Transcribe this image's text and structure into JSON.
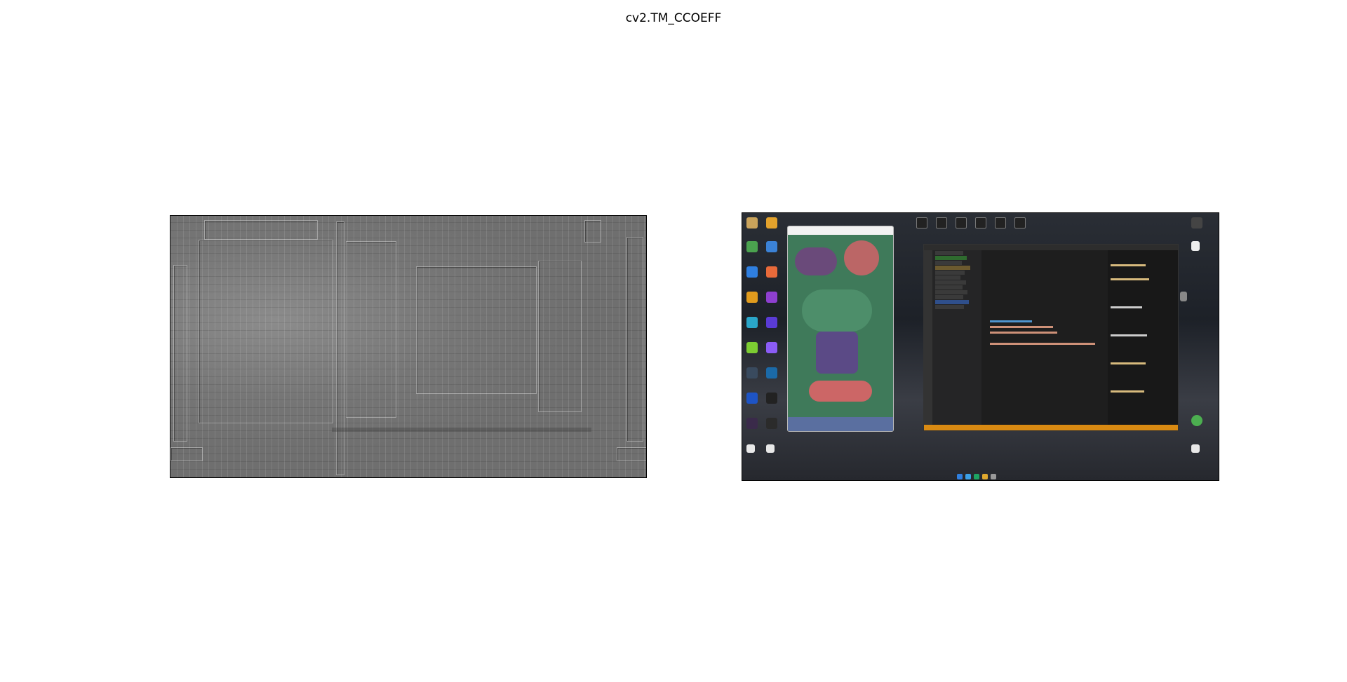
{
  "figure": {
    "title": "cv2.TM_CCOEFF"
  },
  "colors": {
    "background": "#ffffff",
    "left_panel_gray": "#7a7a7a",
    "desktop_dark": "#1d2128",
    "vscode_bg": "#1e1e1e",
    "vscode_status": "#d98a12",
    "phone_game_green": "#3f7a5a"
  },
  "left_panel": {
    "description_icon": "template-match-response-map"
  },
  "right_panel": {
    "desktop_icons": [
      "app-icon",
      "app-icon",
      "app-icon",
      "app-icon",
      "app-icon",
      "app-icon",
      "app-icon",
      "app-icon",
      "app-icon",
      "app-icon",
      "app-icon",
      "app-icon",
      "app-icon",
      "app-icon",
      "app-icon",
      "app-icon"
    ],
    "top_toolbar_icons": [
      "grid-icon",
      "pen-icon",
      "screen-icon",
      "card-icon",
      "brush-icon",
      "settings-icon"
    ],
    "taskbar_icons": [
      "windows-icon",
      "browser-icon",
      "app-icon",
      "folder-icon",
      "app-icon"
    ]
  }
}
